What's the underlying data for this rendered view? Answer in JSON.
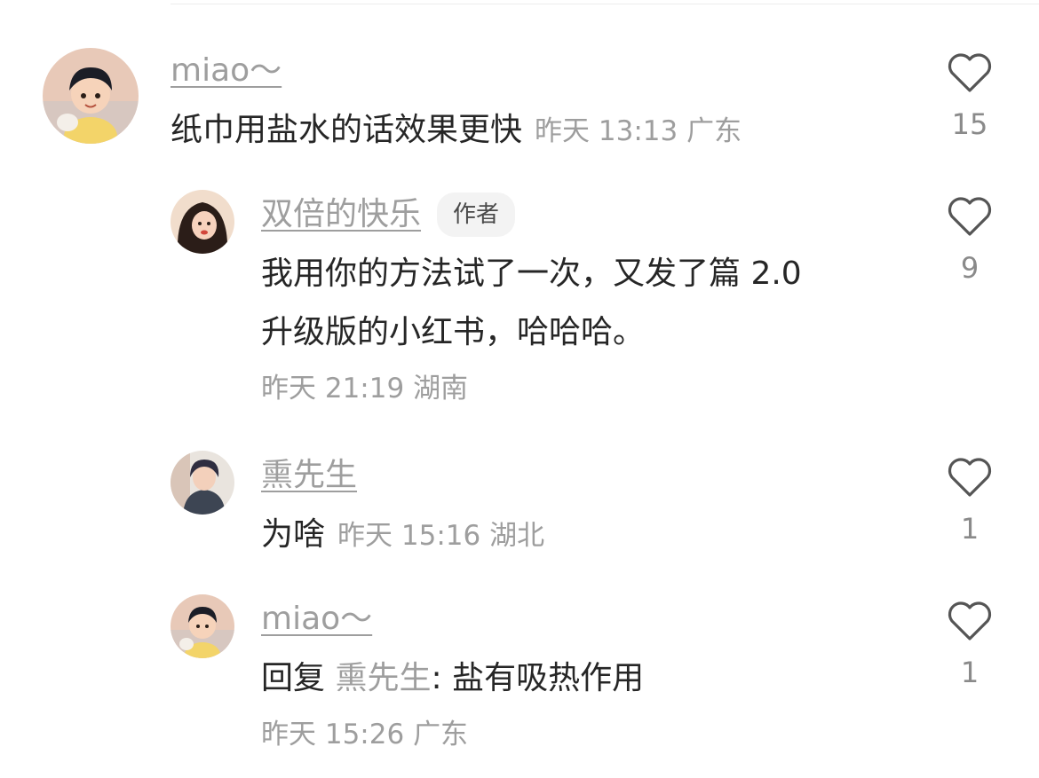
{
  "comments": [
    {
      "name": "miao～",
      "text": "纸巾用盐水的话效果更快",
      "time": "昨天 13:13",
      "location": "广东",
      "likes": "15"
    },
    {
      "name": "双倍的快乐",
      "badge": "作者",
      "text_line1": "我用你的方法试了一次，又发了篇 2.0",
      "text_line2": "升级版的小红书，哈哈哈。",
      "time": "昨天 21:19",
      "location": "湖南",
      "likes": "9"
    },
    {
      "name": "熏先生",
      "text": "为啥",
      "time": "昨天 15:16",
      "location": "湖北",
      "likes": "1"
    },
    {
      "name": "miao～",
      "reply_prefix": "回复",
      "reply_target": "熏先生",
      "reply_sep": ":",
      "text": "盐有吸热作用",
      "time": "昨天 15:26",
      "location": "广东",
      "likes": "1"
    }
  ]
}
